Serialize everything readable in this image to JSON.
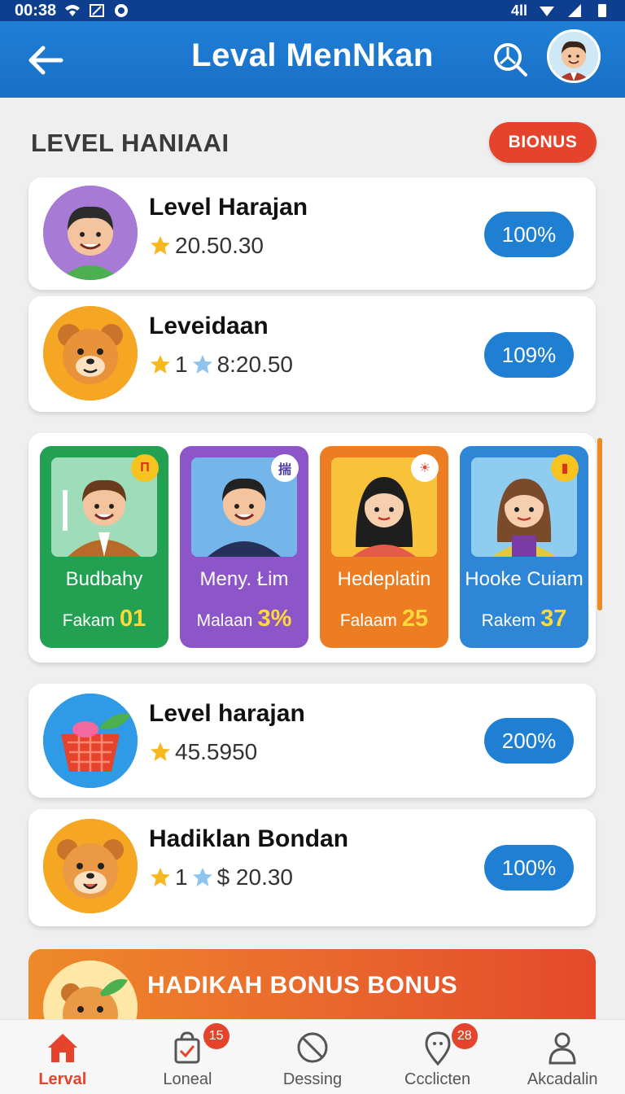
{
  "status_bar": {
    "time": "00:38",
    "signal_text": "4ll"
  },
  "app_bar": {
    "title": "Leval MenNkan",
    "back_icon": "back-arrow-icon",
    "search_icon": "search-icon"
  },
  "section": {
    "title": "LEVEL HANIAAI",
    "bonus_label": "BIONUS"
  },
  "level_rows": [
    {
      "title": "Level Harajan",
      "value": "20.50.30",
      "prefix": "",
      "percent": "100%",
      "avatar": "man-avatar"
    },
    {
      "title": "Leveidaan",
      "value": "8:20.50",
      "prefix": "1",
      "percent": "109%",
      "avatar": "bear-avatar"
    }
  ],
  "tiles": [
    {
      "name": "Budbahy",
      "foot_label": "Fakam",
      "foot_value": "01",
      "badge": "П",
      "color": "#23a152"
    },
    {
      "name": "Meny. Łim",
      "foot_label": "Malaan",
      "foot_value": "3%",
      "badge": "揣",
      "color": "#8d56c8"
    },
    {
      "name": "Hedeplatin",
      "foot_label": "Falaam",
      "foot_value": "25",
      "badge": "☀",
      "color": "#ec7d22"
    },
    {
      "name": "Hooke Cuiam",
      "foot_label": "Rakem",
      "foot_value": "37",
      "badge": "▮",
      "color": "#2f86d6"
    }
  ],
  "level_rows_2": [
    {
      "title": "Level harajan",
      "value": "45.5950",
      "prefix": "",
      "percent": "200%",
      "avatar": "basket-avatar"
    },
    {
      "title": "Hadiklan Bondan",
      "value": "$ 20.30",
      "prefix": "1",
      "percent": "100%",
      "avatar": "hamster-avatar"
    }
  ],
  "promo": {
    "title": "HADIKAH BONUS BONUS"
  },
  "bottom_nav": [
    {
      "label": "Lerval",
      "icon": "home-icon",
      "badge": ""
    },
    {
      "label": "Loneal",
      "icon": "bag-check-icon",
      "badge": "15"
    },
    {
      "label": "Dessing",
      "icon": "prohibited-icon",
      "badge": ""
    },
    {
      "label": "Ccclicten",
      "icon": "location-pin-icon",
      "badge": "28"
    },
    {
      "label": "Akcadalin",
      "icon": "person-icon",
      "badge": ""
    }
  ],
  "colors": {
    "primary": "#1f7fd6",
    "accent": "#e5432b",
    "pill": "#1e7fd3"
  }
}
